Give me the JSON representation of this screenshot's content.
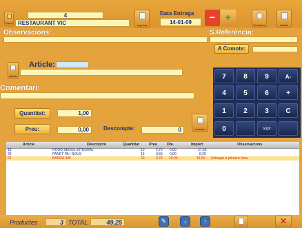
{
  "header": {
    "client_number": "4",
    "client_name": "RESTAURANT VIC",
    "client_caption": "Client",
    "date_label": "Data Entrega",
    "date_value": "14-01-09",
    "captions": {
      "print": "Imprimir",
      "pending": "Pendents",
      "list": "Llistats"
    }
  },
  "observations": {
    "label": "Observacions:",
    "value": ""
  },
  "reference": {
    "label": "S.Referència:",
    "value": "",
    "comote_label": "A Comote:",
    "comote_value": ""
  },
  "article": {
    "label": "Article:",
    "code": "",
    "description": "",
    "caption": "Article"
  },
  "comment": {
    "label": "Comentari:",
    "value": ""
  },
  "quantity": {
    "label": "Quantitat:",
    "value": "1,00"
  },
  "price": {
    "label": "Preu:",
    "value": "0,00"
  },
  "discount": {
    "label": "Descompte:",
    "value": "0"
  },
  "insert_caption": "Insertar",
  "keypad": {
    "keys": [
      "7",
      "8",
      "9",
      "A-",
      "4",
      "5",
      "6",
      "+",
      "1",
      "2",
      "3",
      "C",
      "0",
      "",
      ""
    ],
    "supr": "supr"
  },
  "grid": {
    "headers": [
      "Article",
      "Descripció",
      "Quantitat",
      "Preu",
      "Dte.",
      "Import",
      "Observacions"
    ],
    "rows": [
      {
        "article": "18",
        "desc": "RODO SEGOL INTEGRAL",
        "qty": "10",
        "price": "2,75",
        "dte": "0,00",
        "import": "27,50",
        "obs": ""
      },
      {
        "article": "29",
        "desc": "PANET PA I NOUS",
        "qty": "15",
        "price": "0,55",
        "dte": "0,00",
        "import": "8,25",
        "obs": ""
      },
      {
        "article": "92",
        "desc": "BARRA 400",
        "qty": "20",
        "price": "0,75",
        "dte": "10,00",
        "import": "13,50",
        "obs": "Entregar a primera hora"
      }
    ]
  },
  "footer": {
    "products_label": "Productes",
    "products_count": "3",
    "total_label": "TOTAL",
    "total_value": "49,25"
  },
  "colors": {
    "accent": "#e4a33c",
    "keypad": "#1e2d57",
    "selected_row": "#fbe38a",
    "close": "#e02a2a"
  }
}
